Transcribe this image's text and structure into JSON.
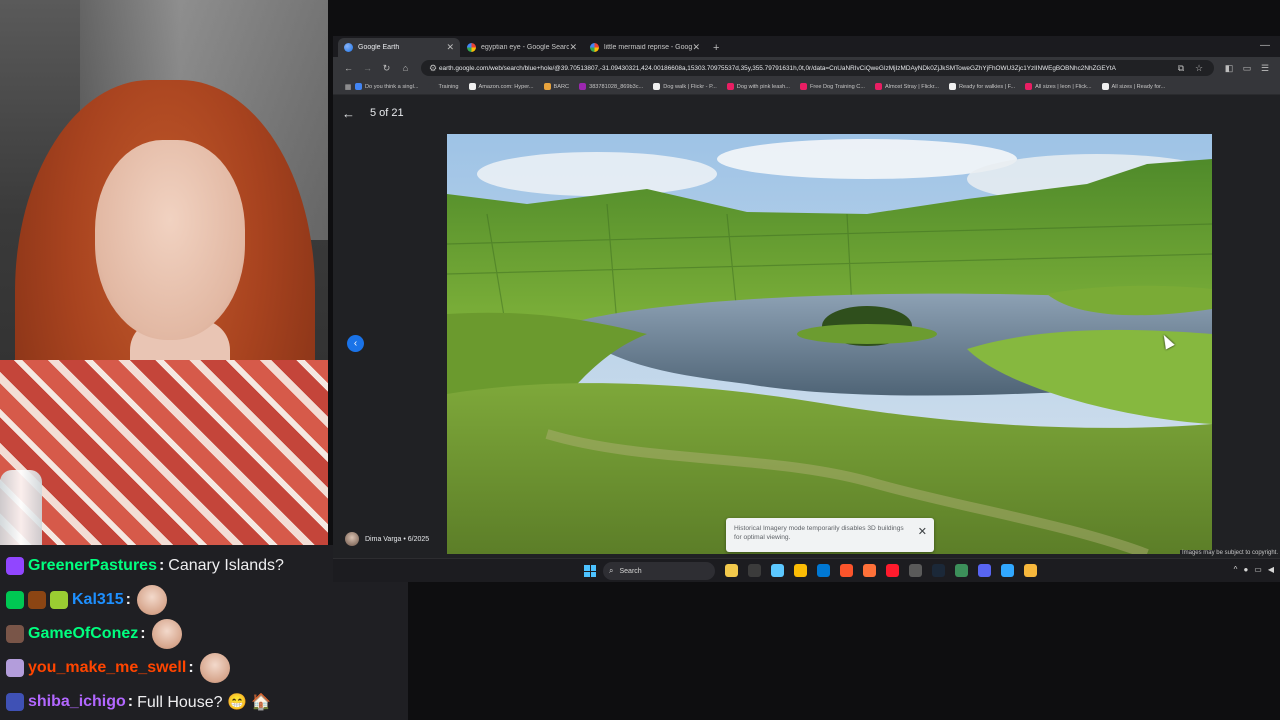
{
  "browser": {
    "tabs": [
      {
        "title": "Google Earth",
        "favicon": "google-earth-icon",
        "active": true
      },
      {
        "title": "egyptian eye - Google Search",
        "favicon": "google-icon",
        "active": false
      },
      {
        "title": "little mermaid reprise - Googl",
        "favicon": "google-icon",
        "active": false
      }
    ],
    "new_tab_label": "+",
    "url": "earth.google.com/web/search/blue+hole/@39.70513807,-31.09430321,424.00186608a,15303.70975537d,35y,355.79791631h,0t,0r/data=CnUaNRIvCiQweGIzMjIzMDAyNDk0ZjJkSMToweGZhYjFhOWU3Zjc1YzlINWEgBOBNhc2NhZGEYtA"
  },
  "bookmarks": [
    {
      "label": "Do you think a singl...",
      "color": "#4285f4"
    },
    {
      "label": "Training",
      "color": "#35363a"
    },
    {
      "label": "Amazon.com: Hyper...",
      "color": "#f0f0f0"
    },
    {
      "label": "BARC",
      "color": "#e8a33d"
    },
    {
      "label": "383781028_869b3c...",
      "color": "#9c27b0"
    },
    {
      "label": "Dog walk | Flickr - P...",
      "color": "#f0f0f0"
    },
    {
      "label": "Dog with pink leash...",
      "color": "#e91e63"
    },
    {
      "label": "Free Dog Training C...",
      "color": "#e91e63"
    },
    {
      "label": "Almost Stray | Flickr...",
      "color": "#e91e63"
    },
    {
      "label": "Ready for walkies | F...",
      "color": "#f0f0f0"
    },
    {
      "label": "All sizes | leon | Flick...",
      "color": "#e91e63"
    },
    {
      "label": "All sizes | Ready for...",
      "color": "#f0f0f0"
    }
  ],
  "viewer": {
    "counter": "5 of 21",
    "credit": "Dima Varga • 6/2025",
    "copyright": "Images may be subject to copyright.",
    "toast": "Historical Imagery mode temporarily disables 3D buildings for optimal viewing."
  },
  "taskbar": {
    "search_placeholder": "Search",
    "apps": [
      "file-explorer-icon",
      "store-icon",
      "copilot-icon",
      "chrome-icon",
      "edge-icon",
      "brave-icon",
      "firefox-icon",
      "opera-icon",
      "obs-icon",
      "steam-icon",
      "chrome-dev-icon",
      "discord-icon",
      "photoshop-icon",
      "chrome-canary-icon"
    ]
  },
  "chat": [
    {
      "user": "GreenerPastures",
      "color": "#00ff7f",
      "badges": [
        "#9146ff"
      ],
      "emoji_badge": "🐟",
      "message": "Canary Islands?",
      "emote": false
    },
    {
      "user": "Kal315",
      "color": "#1e90ff",
      "badges": [
        "#00c853",
        "#8b4513",
        "#9acd32"
      ],
      "emoji_badge": "",
      "message": "",
      "emote": true
    },
    {
      "user": "GameOfConez",
      "color": "#00ff7f",
      "badges": [
        "#795548"
      ],
      "emoji_badge": "",
      "message": "",
      "emote": true
    },
    {
      "user": "you_make_me_swell",
      "color": "#ff4500",
      "badges": [
        "#b39ddb"
      ],
      "emoji_badge": "",
      "message": "",
      "emote": true
    },
    {
      "user": "shiba_ichigo",
      "color": "#b267ff",
      "badges": [
        "#3f51b5"
      ],
      "emoji_badge": "",
      "message": "Full House? 😁 🏠",
      "emote": false
    }
  ],
  "chat_colon": ":"
}
